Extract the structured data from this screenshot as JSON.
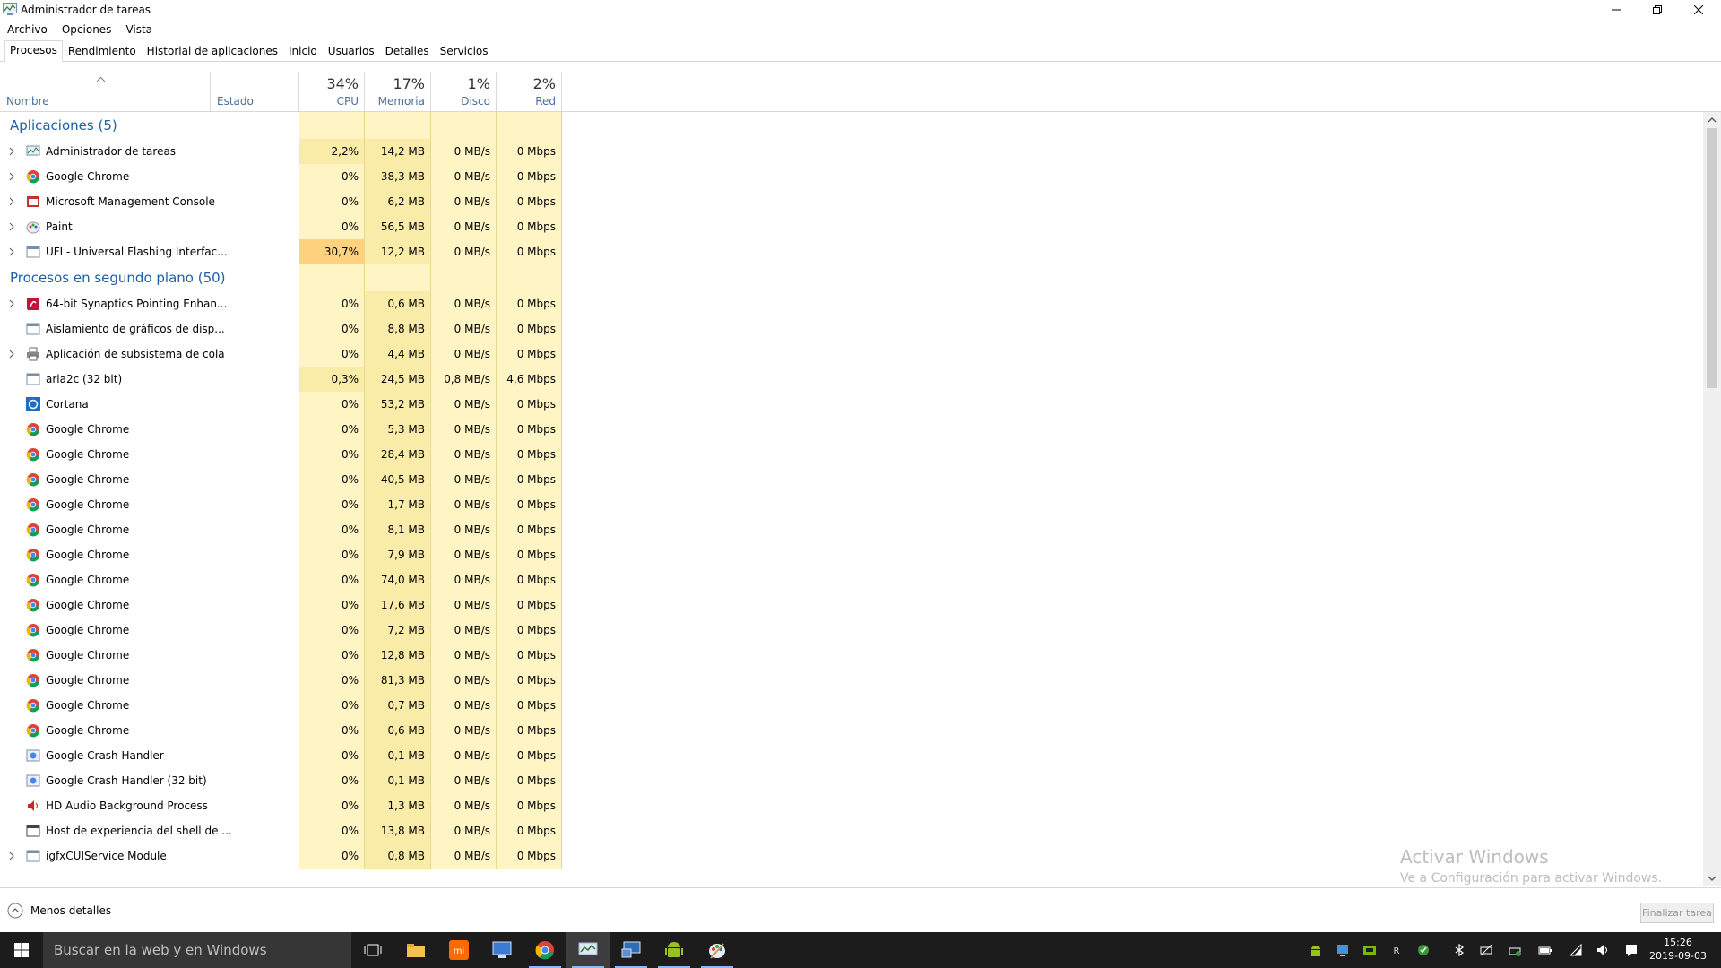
{
  "window": {
    "title": "Administrador de tareas"
  },
  "menu": [
    "Archivo",
    "Opciones",
    "Vista"
  ],
  "tabs": [
    {
      "label": "Procesos",
      "active": true
    },
    {
      "label": "Rendimiento"
    },
    {
      "label": "Historial de aplicaciones"
    },
    {
      "label": "Inicio"
    },
    {
      "label": "Usuarios"
    },
    {
      "label": "Detalles"
    },
    {
      "label": "Servicios"
    }
  ],
  "columns": {
    "name": "Nombre",
    "status": "Estado",
    "cpu": {
      "pct": "34%",
      "label": "CPU"
    },
    "memory": {
      "pct": "17%",
      "label": "Memoria"
    },
    "disk": {
      "pct": "1%",
      "label": "Disco"
    },
    "network": {
      "pct": "2%",
      "label": "Red"
    }
  },
  "groups": [
    {
      "title": "Aplicaciones (5)",
      "rows": [
        {
          "name": "Administrador de tareas",
          "icon": "taskmgr",
          "expand": true,
          "cpu": "2,2%",
          "mem": "14,2 MB",
          "disk": "0 MB/s",
          "net": "0 Mbps",
          "cpu_level": 2
        },
        {
          "name": "Google Chrome",
          "icon": "chrome",
          "expand": true,
          "cpu": "0%",
          "mem": "38,3 MB",
          "disk": "0 MB/s",
          "net": "0 Mbps",
          "cpu_level": 1
        },
        {
          "name": "Microsoft Management Console",
          "icon": "mmc",
          "expand": true,
          "cpu": "0%",
          "mem": "6,2 MB",
          "disk": "0 MB/s",
          "net": "0 Mbps",
          "cpu_level": 1
        },
        {
          "name": "Paint",
          "icon": "paint",
          "expand": true,
          "cpu": "0%",
          "mem": "56,5 MB",
          "disk": "0 MB/s",
          "net": "0 Mbps",
          "cpu_level": 1
        },
        {
          "name": "UFI - Universal Flashing Interfac...",
          "icon": "window",
          "expand": true,
          "cpu": "30,7%",
          "mem": "12,2 MB",
          "disk": "0 MB/s",
          "net": "0 Mbps",
          "cpu_level": 3
        }
      ]
    },
    {
      "title": "Procesos en segundo plano (50)",
      "rows": [
        {
          "name": "64-bit Synaptics Pointing Enhan...",
          "icon": "synaptics",
          "expand": true,
          "cpu": "0%",
          "mem": "0,6 MB",
          "disk": "0 MB/s",
          "net": "0 Mbps",
          "cpu_level": 1
        },
        {
          "name": "Aislamiento de gráficos de disp...",
          "icon": "window",
          "expand": false,
          "cpu": "0%",
          "mem": "8,8 MB",
          "disk": "0 MB/s",
          "net": "0 Mbps",
          "cpu_level": 1
        },
        {
          "name": "Aplicación de subsistema de cola",
          "icon": "printer",
          "expand": true,
          "cpu": "0%",
          "mem": "4,4 MB",
          "disk": "0 MB/s",
          "net": "0 Mbps",
          "cpu_level": 1
        },
        {
          "name": "aria2c (32 bit)",
          "icon": "window",
          "expand": false,
          "cpu": "0,3%",
          "mem": "24,5 MB",
          "disk": "0,8 MB/s",
          "net": "4,6 Mbps",
          "cpu_level": 2
        },
        {
          "name": "Cortana",
          "icon": "cortana",
          "expand": false,
          "cpu": "0%",
          "mem": "53,2 MB",
          "disk": "0 MB/s",
          "net": "0 Mbps",
          "cpu_level": 1
        },
        {
          "name": "Google Chrome",
          "icon": "chrome",
          "expand": false,
          "cpu": "0%",
          "mem": "5,3 MB",
          "disk": "0 MB/s",
          "net": "0 Mbps",
          "cpu_level": 1
        },
        {
          "name": "Google Chrome",
          "icon": "chrome",
          "expand": false,
          "cpu": "0%",
          "mem": "28,4 MB",
          "disk": "0 MB/s",
          "net": "0 Mbps",
          "cpu_level": 1
        },
        {
          "name": "Google Chrome",
          "icon": "chrome",
          "expand": false,
          "cpu": "0%",
          "mem": "40,5 MB",
          "disk": "0 MB/s",
          "net": "0 Mbps",
          "cpu_level": 1
        },
        {
          "name": "Google Chrome",
          "icon": "chrome",
          "expand": false,
          "cpu": "0%",
          "mem": "1,7 MB",
          "disk": "0 MB/s",
          "net": "0 Mbps",
          "cpu_level": 1
        },
        {
          "name": "Google Chrome",
          "icon": "chrome",
          "expand": false,
          "cpu": "0%",
          "mem": "8,1 MB",
          "disk": "0 MB/s",
          "net": "0 Mbps",
          "cpu_level": 1
        },
        {
          "name": "Google Chrome",
          "icon": "chrome",
          "expand": false,
          "cpu": "0%",
          "mem": "7,9 MB",
          "disk": "0 MB/s",
          "net": "0 Mbps",
          "cpu_level": 1
        },
        {
          "name": "Google Chrome",
          "icon": "chrome",
          "expand": false,
          "cpu": "0%",
          "mem": "74,0 MB",
          "disk": "0 MB/s",
          "net": "0 Mbps",
          "cpu_level": 1
        },
        {
          "name": "Google Chrome",
          "icon": "chrome",
          "expand": false,
          "cpu": "0%",
          "mem": "17,6 MB",
          "disk": "0 MB/s",
          "net": "0 Mbps",
          "cpu_level": 1
        },
        {
          "name": "Google Chrome",
          "icon": "chrome",
          "expand": false,
          "cpu": "0%",
          "mem": "7,2 MB",
          "disk": "0 MB/s",
          "net": "0 Mbps",
          "cpu_level": 1
        },
        {
          "name": "Google Chrome",
          "icon": "chrome",
          "expand": false,
          "cpu": "0%",
          "mem": "12,8 MB",
          "disk": "0 MB/s",
          "net": "0 Mbps",
          "cpu_level": 1
        },
        {
          "name": "Google Chrome",
          "icon": "chrome",
          "expand": false,
          "cpu": "0%",
          "mem": "81,3 MB",
          "disk": "0 MB/s",
          "net": "0 Mbps",
          "cpu_level": 1
        },
        {
          "name": "Google Chrome",
          "icon": "chrome",
          "expand": false,
          "cpu": "0%",
          "mem": "0,7 MB",
          "disk": "0 MB/s",
          "net": "0 Mbps",
          "cpu_level": 1
        },
        {
          "name": "Google Chrome",
          "icon": "chrome",
          "expand": false,
          "cpu": "0%",
          "mem": "0,6 MB",
          "disk": "0 MB/s",
          "net": "0 Mbps",
          "cpu_level": 1
        },
        {
          "name": "Google Crash Handler",
          "icon": "crash",
          "expand": false,
          "cpu": "0%",
          "mem": "0,1 MB",
          "disk": "0 MB/s",
          "net": "0 Mbps",
          "cpu_level": 1
        },
        {
          "name": "Google Crash Handler (32 bit)",
          "icon": "crash",
          "expand": false,
          "cpu": "0%",
          "mem": "0,1 MB",
          "disk": "0 MB/s",
          "net": "0 Mbps",
          "cpu_level": 1
        },
        {
          "name": "HD Audio Background Process",
          "icon": "speaker",
          "expand": false,
          "cpu": "0%",
          "mem": "1,3 MB",
          "disk": "0 MB/s",
          "net": "0 Mbps",
          "cpu_level": 1
        },
        {
          "name": "Host de experiencia del shell de ...",
          "icon": "window-dark",
          "expand": false,
          "cpu": "0%",
          "mem": "13,8 MB",
          "disk": "0 MB/s",
          "net": "0 Mbps",
          "cpu_level": 1
        },
        {
          "name": "igfxCUIService Module",
          "icon": "window",
          "expand": true,
          "cpu": "0%",
          "mem": "0,8 MB",
          "disk": "0 MB/s",
          "net": "0 Mbps",
          "cpu_level": 1
        }
      ]
    }
  ],
  "footer": {
    "less_details": "Menos detalles",
    "end_task": "Finalizar tarea"
  },
  "watermark": {
    "line1": "Activar Windows",
    "line2": "Ve a Configuración para activar Windows."
  },
  "taskbar": {
    "search_placeholder": "Buscar en la web y en Windows",
    "apps": [
      "task-view-icon",
      "file-explorer-icon",
      "mi-icon",
      "monitor-app-icon",
      "chrome-icon",
      "task-manager-icon",
      "network-app-icon",
      "android-icon",
      "paint-icon"
    ],
    "time": "15:26",
    "date": "2019-09-03"
  },
  "colors": {
    "accent": "#1f5fa6",
    "cpu_low": "#fff4c4",
    "cpu_mid": "#f9eca8",
    "cpu_high": "#ffd27f"
  }
}
